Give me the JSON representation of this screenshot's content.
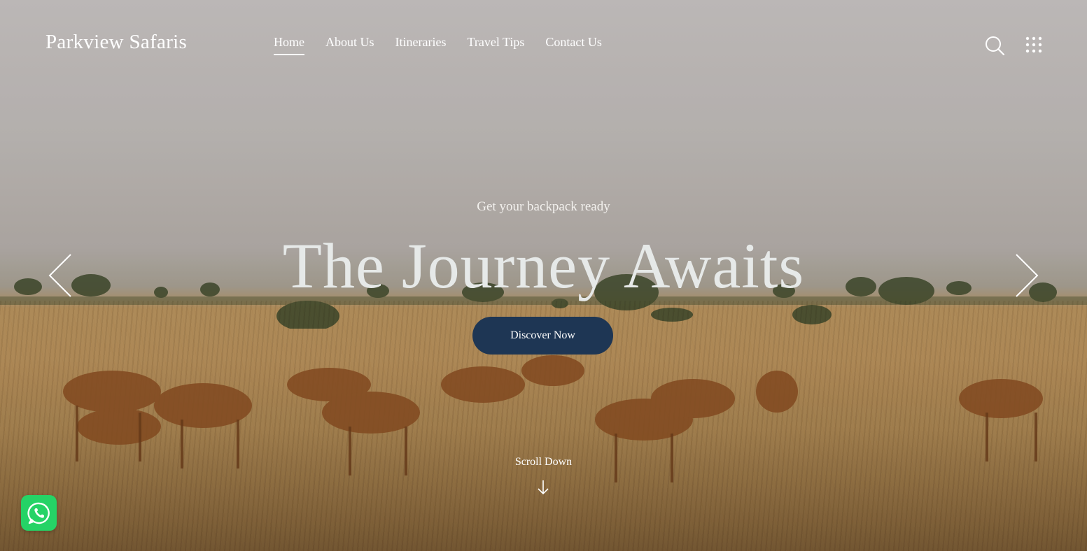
{
  "brand": {
    "name": "Parkview Safaris"
  },
  "nav": {
    "items": [
      {
        "label": "Home",
        "active": true
      },
      {
        "label": "About Us",
        "active": false
      },
      {
        "label": "Itineraries",
        "active": false
      },
      {
        "label": "Travel Tips",
        "active": false
      },
      {
        "label": "Contact Us",
        "active": false
      }
    ]
  },
  "header_icons": {
    "search": "search-icon",
    "menu": "grid-menu-icon"
  },
  "hero": {
    "kicker": "Get your backpack ready",
    "headline": "The Journey Awaits",
    "cta_label": "Discover Now",
    "prev_icon": "chevron-left-icon",
    "next_icon": "chevron-right-icon",
    "scroll_label": "Scroll Down",
    "scroll_icon": "arrow-down-icon",
    "background": "savanna-antelope-herd"
  },
  "whatsapp": {
    "icon": "whatsapp-icon",
    "color": "#25d366"
  },
  "colors": {
    "accent": "#1e3654",
    "text": "#ffffff"
  }
}
